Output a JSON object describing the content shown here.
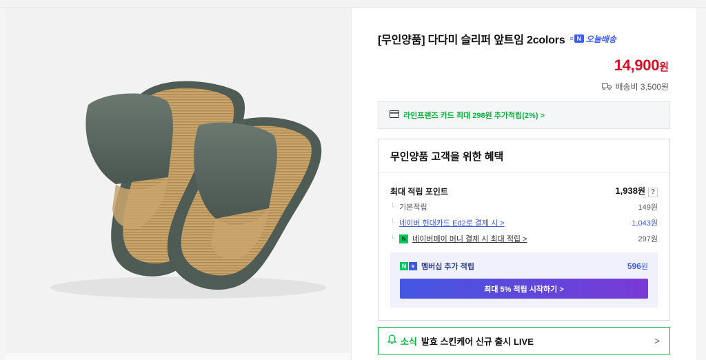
{
  "product": {
    "title": "[무인양품] 다다미 슬리퍼 앞트임 2colors",
    "delivery_badge": "오늘배송",
    "delivery_badge_letter": "N",
    "price_number": "14,900",
    "price_unit": "원",
    "shipping": "배송비 3,500원",
    "image_icon": "tatami-slippers-image"
  },
  "card_promo": {
    "text": "라인프렌즈 카드 최대 298원 추가적립(2%) >",
    "icon": "credit-card-icon"
  },
  "benefits": {
    "title": "무인양품 고객을 위한 혜택",
    "max_points_label": "최대 적립 포인트",
    "max_points_value": "1,938",
    "max_points_unit": "원",
    "help": "?",
    "rows": [
      {
        "label": "기본적립",
        "value": "149원"
      },
      {
        "label": "네이버 현대카드 Ed2로 결제 시 >",
        "value": "1,043원"
      },
      {
        "label": "네이버페이 머니 결제 시 최대 적립 >",
        "value": "297원"
      }
    ],
    "npay_letter": "N",
    "membership": {
      "label": "멤버십 추가 적립",
      "value": "596",
      "unit": "원",
      "badge_n": "N",
      "badge_plus": "+",
      "button": "최대 5% 적립 시작하기 >"
    }
  },
  "news": {
    "tag": "소식",
    "text": "발효 스킨케어 신규 출시 LIVE",
    "chevron": ">"
  },
  "colors": {
    "price_red": "#d30f25",
    "naver_green": "#07b53b",
    "link_blue": "#3e59d9",
    "delivery_blue": "#3b5bfd"
  }
}
